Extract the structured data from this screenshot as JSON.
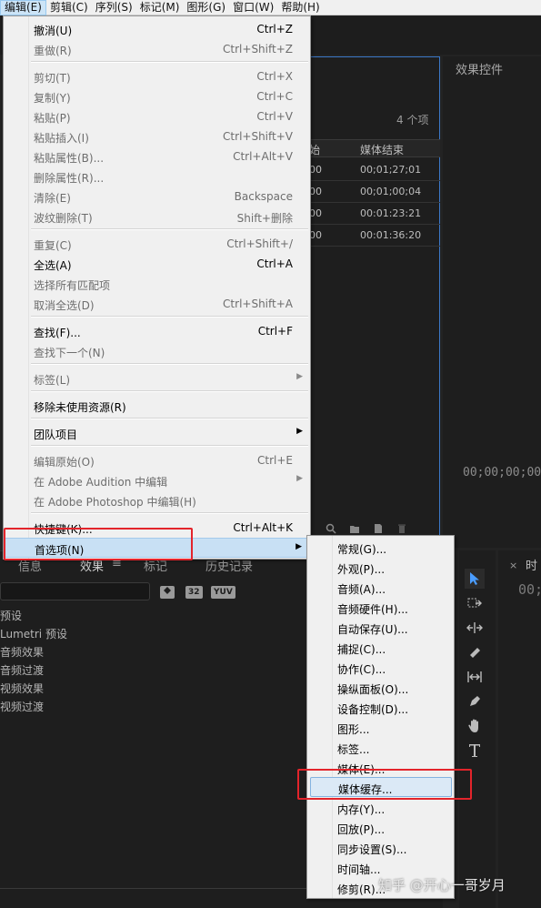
{
  "menubar": {
    "items": [
      "编辑(E)",
      "剪辑(C)",
      "序列(S)",
      "标记(M)",
      "图形(G)",
      "窗口(W)",
      "帮助(H)"
    ]
  },
  "project_panel": {
    "item_count": "4 个项",
    "col_start_partial": "始",
    "col_end": "媒体结束",
    "rows": [
      {
        "start": "00",
        "end": "00;01;27;01"
      },
      {
        "start": "00",
        "end": "00;01;00;04"
      },
      {
        "start": "00",
        "end": "00:01:23:21"
      },
      {
        "start": "00",
        "end": "00:01:36:20"
      }
    ]
  },
  "effect_controls": {
    "title": "效果控件",
    "timecode": "00;00;00;00"
  },
  "bottom_panel": {
    "tabs": [
      "信息",
      "效果",
      "标记",
      "历史记录"
    ],
    "tab_menu_glyph": "≡",
    "filter_icons": [
      "32",
      "YUV"
    ],
    "items": [
      "预设",
      "Lumetri 预设",
      "音频效果",
      "音频过渡",
      "视频效果",
      "视频过渡"
    ]
  },
  "timeline": {
    "close": "×",
    "title": "时",
    "time": "00;"
  },
  "edit_menu": {
    "items": [
      {
        "label": "撤消(U)",
        "shortcut": "Ctrl+Z",
        "disabled": false
      },
      {
        "label": "重做(R)",
        "shortcut": "Ctrl+Shift+Z",
        "disabled": true
      },
      {
        "label": "剪切(T)",
        "shortcut": "Ctrl+X",
        "disabled": true
      },
      {
        "label": "复制(Y)",
        "shortcut": "Ctrl+C",
        "disabled": true
      },
      {
        "label": "粘贴(P)",
        "shortcut": "Ctrl+V",
        "disabled": true
      },
      {
        "label": "粘贴插入(I)",
        "shortcut": "Ctrl+Shift+V",
        "disabled": true
      },
      {
        "label": "粘贴属性(B)...",
        "shortcut": "Ctrl+Alt+V",
        "disabled": true
      },
      {
        "label": "删除属性(R)...",
        "shortcut": "",
        "disabled": true
      },
      {
        "label": "清除(E)",
        "shortcut": "Backspace",
        "disabled": true
      },
      {
        "label": "波纹删除(T)",
        "shortcut": "Shift+删除",
        "disabled": true
      },
      {
        "label": "重复(C)",
        "shortcut": "Ctrl+Shift+/",
        "disabled": true
      },
      {
        "label": "全选(A)",
        "shortcut": "Ctrl+A",
        "disabled": false
      },
      {
        "label": "选择所有匹配项",
        "shortcut": "",
        "disabled": true
      },
      {
        "label": "取消全选(D)",
        "shortcut": "Ctrl+Shift+A",
        "disabled": true
      },
      {
        "label": "查找(F)...",
        "shortcut": "Ctrl+F",
        "disabled": false
      },
      {
        "label": "查找下一个(N)",
        "shortcut": "",
        "disabled": true
      },
      {
        "label": "标签(L)",
        "shortcut": "",
        "disabled": true,
        "submenu": true
      },
      {
        "label": "移除未使用资源(R)",
        "shortcut": "",
        "disabled": false
      },
      {
        "label": "团队项目",
        "shortcut": "",
        "disabled": false,
        "submenu": true
      },
      {
        "label": "编辑原始(O)",
        "shortcut": "Ctrl+E",
        "disabled": true
      },
      {
        "label": "在 Adobe Audition 中编辑",
        "shortcut": "",
        "disabled": true,
        "submenu": true
      },
      {
        "label": "在 Adobe Photoshop 中编辑(H)",
        "shortcut": "",
        "disabled": true
      },
      {
        "label": "快捷键(K)...",
        "shortcut": "Ctrl+Alt+K",
        "disabled": false
      },
      {
        "label": "首选项(N)",
        "shortcut": "",
        "disabled": false,
        "submenu": true,
        "highlighted": true
      }
    ]
  },
  "preferences_menu": {
    "items": [
      {
        "label": "常规(G)..."
      },
      {
        "label": "外观(P)..."
      },
      {
        "label": "音频(A)..."
      },
      {
        "label": "音频硬件(H)..."
      },
      {
        "label": "自动保存(U)..."
      },
      {
        "label": "捕捉(C)..."
      },
      {
        "label": "协作(C)..."
      },
      {
        "label": "操纵面板(O)..."
      },
      {
        "label": "设备控制(D)..."
      },
      {
        "label": "图形..."
      },
      {
        "label": "标签..."
      },
      {
        "label": "媒体(E)..."
      },
      {
        "label": "媒体缓存...",
        "highlighted": true
      },
      {
        "label": "内存(Y)..."
      },
      {
        "label": "回放(P)..."
      },
      {
        "label": "同步设置(S)..."
      },
      {
        "label": "时间轴..."
      },
      {
        "label": "修剪(R)..."
      }
    ]
  },
  "watermark": "知乎 @开心一哥岁月",
  "colors": {
    "highlight_box": "#e3242b",
    "menu_bg": "#f0f0f0",
    "selection_blue": "#3c78c8"
  }
}
